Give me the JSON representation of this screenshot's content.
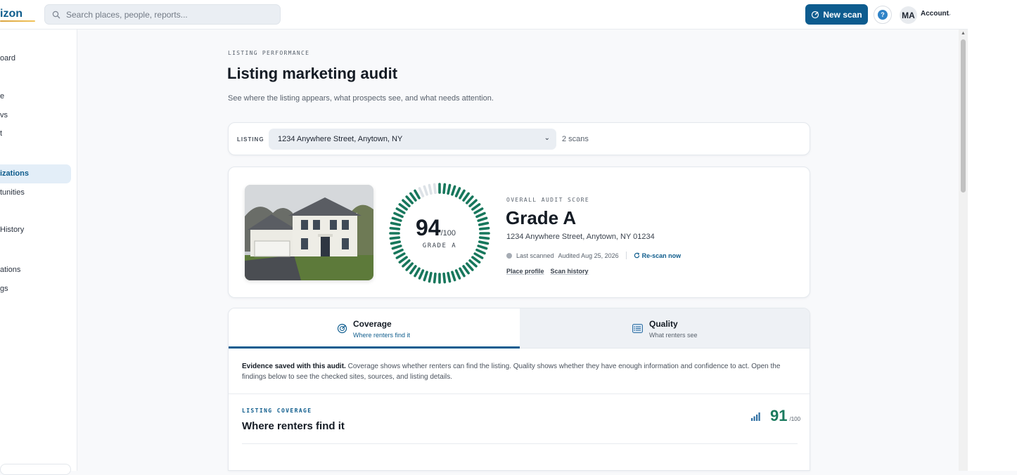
{
  "app": {
    "logo_text": "izon"
  },
  "search": {
    "placeholder": "Search places, people, reports..."
  },
  "header": {
    "new_scan_label": "New scan",
    "help_label": "?",
    "avatar_initials": "MA",
    "account_label": "Account"
  },
  "sidebar": {
    "items": [
      {
        "label": "oard"
      },
      {
        "label": "e"
      },
      {
        "label": "vs"
      },
      {
        "label": "t"
      },
      {
        "label": "izations",
        "active": true
      },
      {
        "label": "tunities"
      },
      {
        "label": "History"
      },
      {
        "label": "ations"
      },
      {
        "label": "gs"
      }
    ]
  },
  "page": {
    "eyebrow": "LISTING PERFORMANCE",
    "title": "Listing marketing audit",
    "subtitle": "See where the listing appears, what prospects see, and what needs attention."
  },
  "listing": {
    "label": "LISTING",
    "selected": "1234 Anywhere Street, Anytown, NY",
    "scans": "2 scans"
  },
  "score": {
    "value": "94",
    "out_of": "/100",
    "grade_label": "GRADE A",
    "overall_label": "OVERALL AUDIT SCORE",
    "grade": "Grade A",
    "address": "1234 Anywhere Street, Anytown, NY 01234",
    "last_scanned": "Last scanned",
    "audited": "Audited Aug 25, 2026",
    "rescan": "Re-scan now",
    "place_profile": "Place profile",
    "scan_history": "Scan history",
    "ring_fraction": 0.94,
    "ring_color": "#17775c"
  },
  "tabs": [
    {
      "title": "Coverage",
      "subtitle": "Where renters find it",
      "active": true
    },
    {
      "title": "Quality",
      "subtitle": "What renters see",
      "active": false
    }
  ],
  "evidence": {
    "bold": "Evidence saved with this audit.",
    "text": " Coverage shows whether renters can find the listing. Quality shows whether they have enough information and confidence to act. Open the findings below to see the checked sites, sources, and listing details."
  },
  "coverage": {
    "eyebrow": "LISTING COVERAGE",
    "title": "Where renters find it",
    "score": "91",
    "out_of": "/100"
  },
  "colors": {
    "accent": "#0d5c8f",
    "score_green": "#17775c"
  }
}
